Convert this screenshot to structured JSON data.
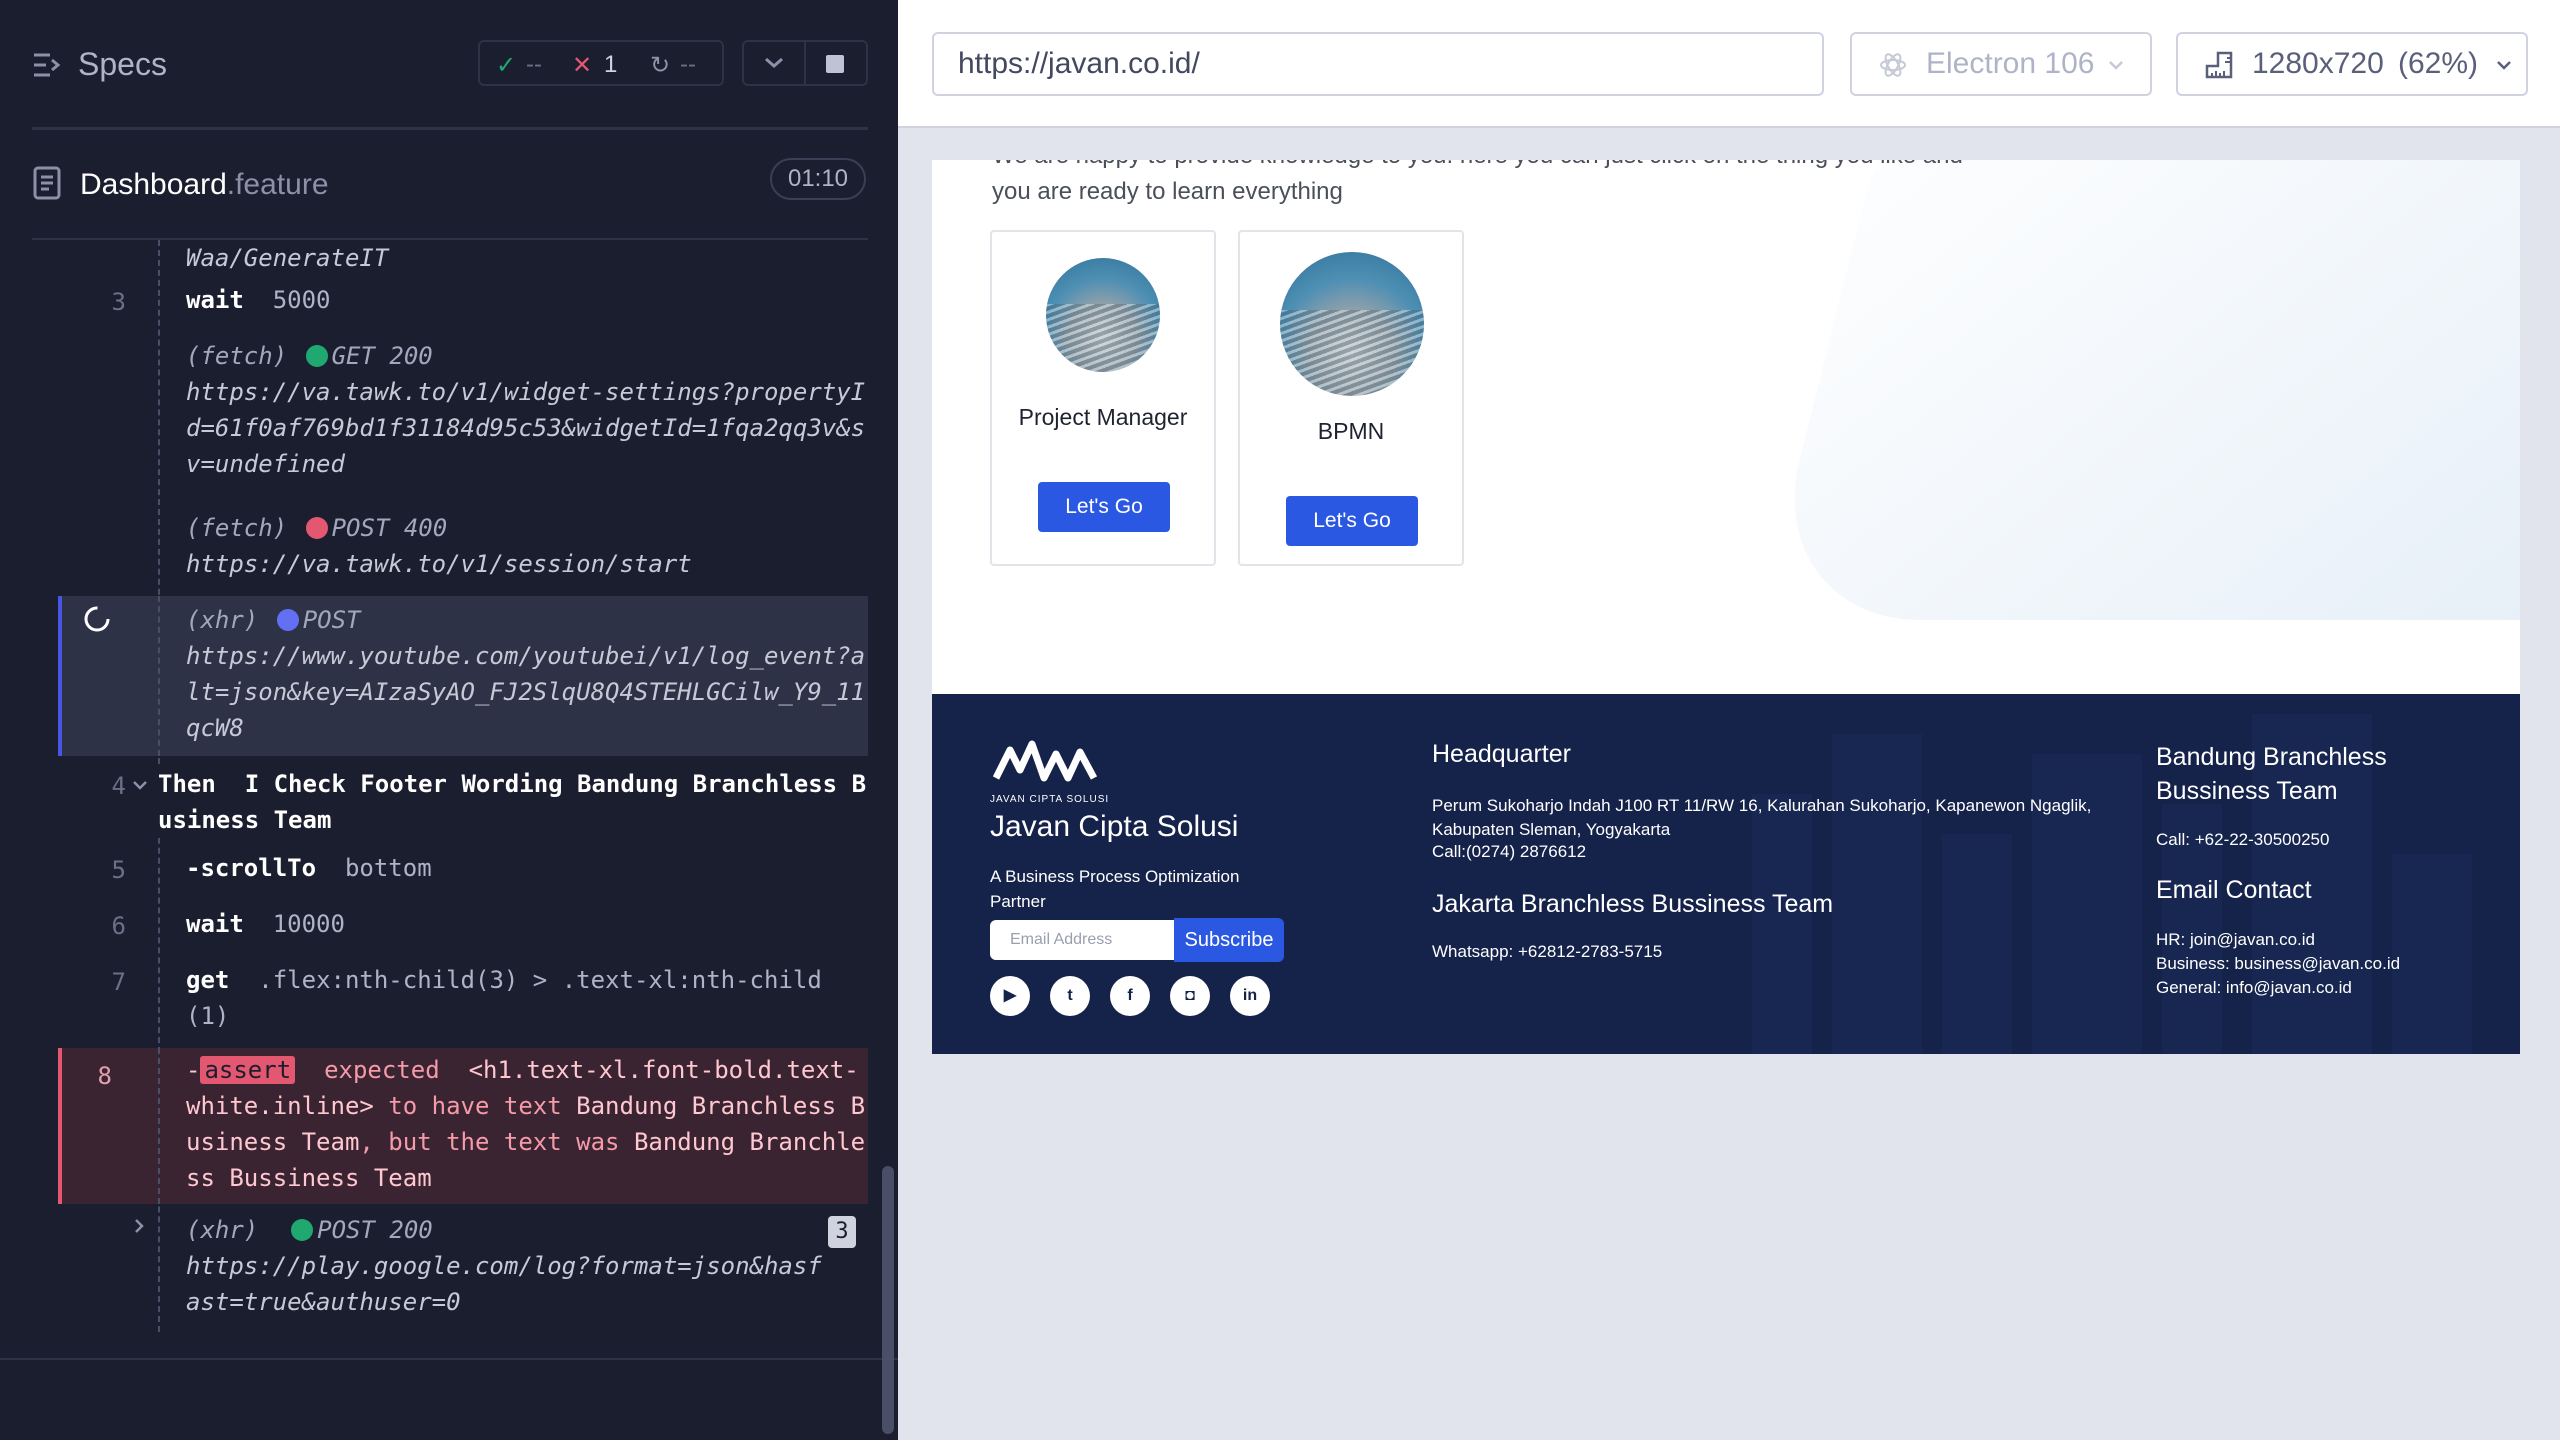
{
  "reporter": {
    "title": "Specs",
    "stats": {
      "passed": "--",
      "failed": "1",
      "pending": "--"
    },
    "file": {
      "name": "Dashboard",
      "ext": ".feature",
      "duration": "01:10"
    }
  },
  "commands": {
    "c0_text": "Waa/GenerateIT",
    "c3_num": "3",
    "c3_name": "wait",
    "c3_arg": "5000",
    "fetch1_type": "(fetch)",
    "fetch1_method": "GET 200",
    "fetch1_url": "https://va.tawk.to/v1/widget-settings?propertyId=61f0af769bd1f31184d95c53&widgetId=1fqa2qq3v&sv=undefined",
    "fetch2_type": "(fetch)",
    "fetch2_method": "POST 400",
    "fetch2_url": "https://va.tawk.to/v1/session/start",
    "xhr1_type": "(xhr)",
    "xhr1_method": "POST",
    "xhr1_url": "https://www.youtube.com/youtubei/v1/log_event?alt=json&key=AIzaSyAO_FJ2SlqU8Q4STEHLGCilw_Y9_11qcW8",
    "c4_num": "4",
    "c4_keyword": "Then",
    "c4_text": "I Check Footer Wording Bandung Branchless Business Team",
    "c5_num": "5",
    "c5_name": "-scrollTo",
    "c5_arg": "bottom",
    "c6_num": "6",
    "c6_name": "wait",
    "c6_arg": "10000",
    "c7_num": "7",
    "c7_name": "get",
    "c7_arg": ".flex:nth-child(3) > .text-xl:nth-child(1)",
    "c8_num": "8",
    "c8_dash": "-",
    "c8_name": "assert",
    "c8_expected": "expected",
    "c8_subject": "<h1.text-xl.font-bold.text-white.inline>",
    "c8_tohave": "to have text",
    "c8_value1": "Bandung Branchless Business Team",
    "c8_but": ", but the text was",
    "c8_value2": "Bandung Branchless Bussiness Team",
    "xhr2_type": "(xhr)",
    "xhr2_method": "POST 200",
    "xhr2_url": "https://play.google.com/log?format=json&hasfast=true&authuser=0",
    "xhr2_count": "3"
  },
  "aut": {
    "url": "https://javan.co.id/",
    "browser": "Electron 106",
    "viewport": "1280x720",
    "scale": "(62%)"
  },
  "page": {
    "intro": "We are happy to provide knowledge to you. here you can just click on the thing you like and you are ready to learn everything",
    "cards": [
      {
        "title": "Project Manager",
        "button": "Let's Go"
      },
      {
        "title": "BPMN",
        "button": "Let's Go"
      }
    ],
    "footer": {
      "logo_small": "JAVAN CIPTA SOLUSI",
      "brand": "Javan Cipta Solusi",
      "tagline": "A Business Process Optimization Partner",
      "email_placeholder": "Email Address",
      "subscribe": "Subscribe",
      "hq_title": "Headquarter",
      "hq_address": "Perum Sukoharjo Indah J100 RT 11/RW 16, Kalurahan Sukoharjo, Kapanewon Ngaglik, Kabupaten Sleman, Yogyakarta",
      "hq_call": "Call:(0274) 2876612",
      "jkt_title": "Jakarta Branchless Bussiness Team",
      "jkt_whatsapp": "Whatsapp: +62812-2783-5715",
      "bdg_title": "Bandung Branchless Bussiness Team",
      "bdg_call": "Call: +62-22-30500250",
      "email_title": "Email Contact",
      "email_hr": "HR: join@javan.co.id",
      "email_business": "Business: business@javan.co.id",
      "email_general": "General: info@javan.co.id",
      "social": [
        "youtube-icon",
        "twitter-icon",
        "facebook-icon",
        "instagram-icon",
        "linkedin-icon"
      ]
    }
  },
  "colors": {
    "pass": "#1fa971",
    "fail": "#e45770",
    "pending_dot": "#6470f3",
    "footer_bg": "#15224a",
    "button_blue": "#2b58e3"
  }
}
